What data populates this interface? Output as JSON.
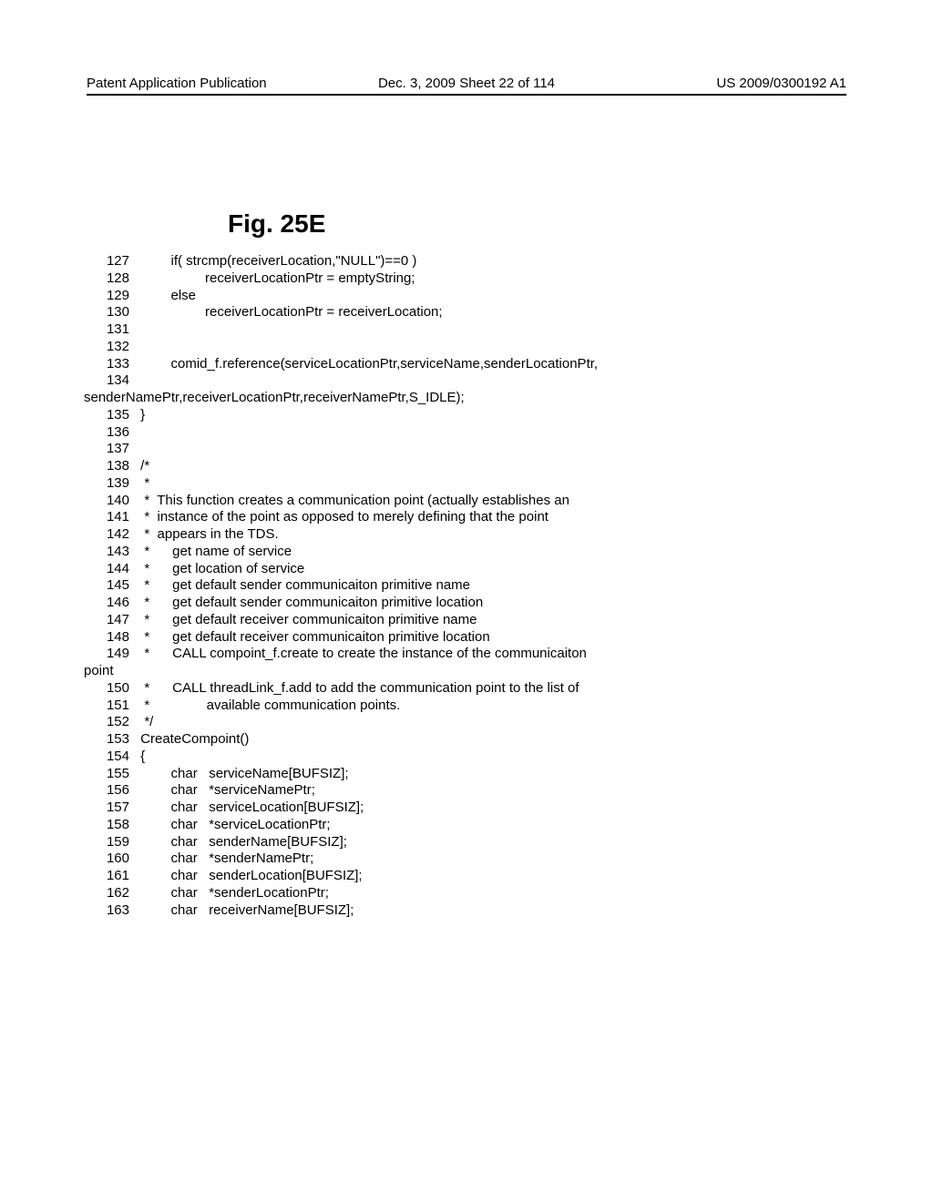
{
  "header": {
    "left": "Patent Application Publication",
    "middle": "Dec. 3, 2009  Sheet 22 of 114",
    "right": "US 2009/0300192 A1"
  },
  "figure": {
    "title": "Fig. 25E"
  },
  "code": {
    "lines": [
      {
        "num": "127",
        "text": "         if( strcmp(receiverLocation,\"NULL\")==0 )"
      },
      {
        "num": "128",
        "text": "                  receiverLocationPtr = emptyString;"
      },
      {
        "num": "129",
        "text": "         else"
      },
      {
        "num": "130",
        "text": "                  receiverLocationPtr = receiverLocation;"
      },
      {
        "num": "131",
        "text": ""
      },
      {
        "num": "132",
        "text": ""
      },
      {
        "num": "133",
        "text": "         comid_f.reference(serviceLocationPtr,serviceName,senderLocationPtr,"
      },
      {
        "num": "134",
        "text": ""
      },
      {
        "num": "",
        "text": "senderNamePtr,receiverLocationPtr,receiverNamePtr,S_IDLE);",
        "noindent": true
      },
      {
        "num": "135",
        "text": " }"
      },
      {
        "num": "136",
        "text": ""
      },
      {
        "num": "137",
        "text": ""
      },
      {
        "num": "138",
        "text": " /*"
      },
      {
        "num": "139",
        "text": "  *"
      },
      {
        "num": "140",
        "text": "  *  This function creates a communication point (actually establishes an"
      },
      {
        "num": "141",
        "text": "  *  instance of the point as opposed to merely defining that the point"
      },
      {
        "num": "142",
        "text": "  *  appears in the TDS."
      },
      {
        "num": "143",
        "text": "  *      get name of service"
      },
      {
        "num": "144",
        "text": "  *      get location of service"
      },
      {
        "num": "145",
        "text": "  *      get default sender communicaiton primitive name"
      },
      {
        "num": "146",
        "text": "  *      get default sender communicaiton primitive location"
      },
      {
        "num": "147",
        "text": "  *      get default receiver communicaiton primitive name"
      },
      {
        "num": "148",
        "text": "  *      get default receiver communicaiton primitive location"
      },
      {
        "num": "149",
        "text": "  *      CALL compoint_f.create to create the instance of the communicaiton"
      },
      {
        "num": "",
        "text": "point",
        "noindent": true
      },
      {
        "num": "150",
        "text": "  *      CALL threadLink_f.add to add the communication point to the list of"
      },
      {
        "num": "151",
        "text": "  *               available communication points."
      },
      {
        "num": "152",
        "text": "  */"
      },
      {
        "num": "153",
        "text": " CreateCompoint()"
      },
      {
        "num": "154",
        "text": " {"
      },
      {
        "num": "155",
        "text": "         char   serviceName[BUFSIZ];"
      },
      {
        "num": "156",
        "text": "         char   *serviceNamePtr;"
      },
      {
        "num": "157",
        "text": "         char   serviceLocation[BUFSIZ];"
      },
      {
        "num": "158",
        "text": "         char   *serviceLocationPtr;"
      },
      {
        "num": "159",
        "text": "         char   senderName[BUFSIZ];"
      },
      {
        "num": "160",
        "text": "         char   *senderNamePtr;"
      },
      {
        "num": "161",
        "text": "         char   senderLocation[BUFSIZ];"
      },
      {
        "num": "162",
        "text": "         char   *senderLocationPtr;"
      },
      {
        "num": "163",
        "text": "         char   receiverName[BUFSIZ];"
      }
    ]
  }
}
